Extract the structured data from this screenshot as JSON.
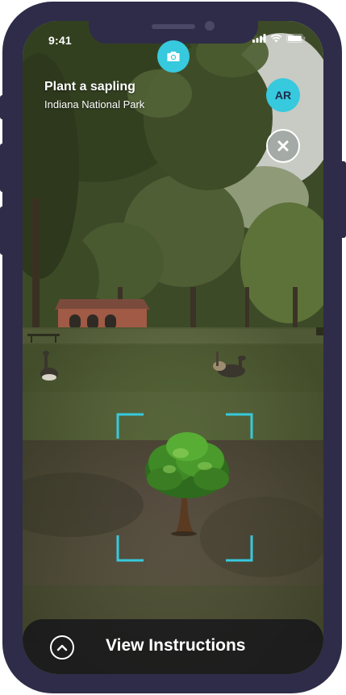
{
  "status_bar": {
    "time": "9:41",
    "icons": [
      "signal-icon",
      "wifi-icon",
      "battery-icon"
    ]
  },
  "header": {
    "title": "Plant a sapling",
    "subtitle": "Indiana National Park"
  },
  "camera_button": {
    "icon": "camera-icon"
  },
  "ar_badge": {
    "label": "AR"
  },
  "close_button": {
    "icon": "close-icon"
  },
  "viewfinder": {
    "object": "tree-model"
  },
  "bottom_bar": {
    "label": "View Instructions",
    "icon": "chevron-up-icon"
  },
  "colors": {
    "accent": "#37c9dd",
    "frame": "#2e2c48",
    "bar": "#12121a"
  }
}
